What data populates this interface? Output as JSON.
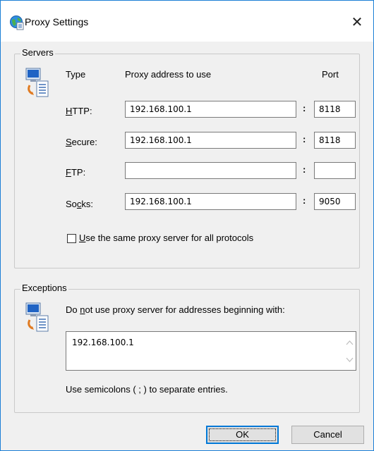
{
  "window": {
    "title": "Proxy Settings",
    "close_glyph": "✕"
  },
  "servers": {
    "group_label": "Servers",
    "col_type": "Type",
    "col_address": "Proxy address to use",
    "col_port": "Port",
    "rows": [
      {
        "key": "H",
        "rest": "TTP:",
        "address": "192.168.100.1",
        "port": "8118"
      },
      {
        "key": "S",
        "rest": "ecure:",
        "address": "192.168.100.1",
        "port": "8118"
      },
      {
        "key": "F",
        "rest": "TP:",
        "address": "",
        "port": ""
      },
      {
        "pre": "So",
        "key": "c",
        "rest": "ks:",
        "address": "192.168.100.1",
        "port": "9050"
      }
    ],
    "colon": ":",
    "same_proxy": {
      "key": "U",
      "rest": "se the same proxy server for all protocols",
      "checked": false
    }
  },
  "exceptions": {
    "group_label": "Exceptions",
    "desc_pre": "Do ",
    "desc_key": "n",
    "desc_rest": "ot use proxy server for addresses beginning with:",
    "value": "192.168.100.1",
    "hint": "Use semicolons ( ; ) to separate entries."
  },
  "buttons": {
    "ok": "OK",
    "cancel": "Cancel"
  },
  "icons": {
    "title": "globe-icon",
    "servers": "network-computer-icon",
    "exceptions": "network-computer-icon"
  }
}
